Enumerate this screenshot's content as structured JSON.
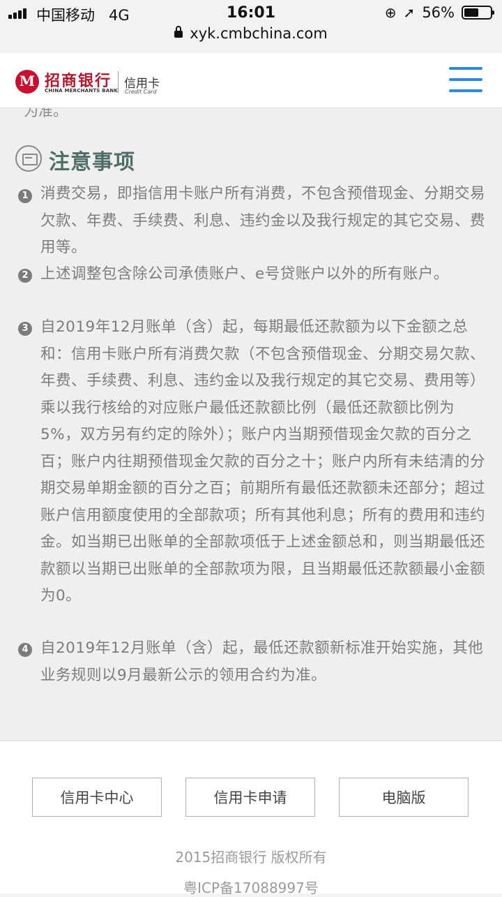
{
  "status_bar": {
    "carrier": "中国移动",
    "network": "4G",
    "time": "16:01",
    "battery": "56%",
    "battery_level": 0.56
  },
  "url_bar": {
    "url": "xyk.cmbchina.com"
  },
  "header": {
    "logo_cn": "招商银行",
    "logo_en": "CHINA MERCHANTS BANK",
    "logo_card": "信用卡",
    "logo_card_en": "Credit Card"
  },
  "content": {
    "cut_off_text": "为准。",
    "section_title": "注意事项",
    "items": [
      {
        "num": "1",
        "text": "消费交易，即指信用卡账户所有消费，不包含预借现金、分期交易欠款、年费、手续费、利息、违约金以及我行规定的其它交易、费用等。"
      },
      {
        "num": "2",
        "text": "上述调整包含除公司承债账户、e号贷账户以外的所有账户。"
      },
      {
        "num": "3",
        "text": "自2019年12月账单（含）起，每期最低还款额为以下金额之总和：信用卡账户所有消费欠款（不包含预借现金、分期交易欠款、年费、手续费、利息、违约金以及我行规定的其它交易、费用等）乘以我行核给的对应账户最低还款额比例（最低还款额比例为5%，双方另有约定的除外）；账户内当期预借现金欠款的百分之百；账户内往期预借现金欠款的百分之十；账户内所有未结清的分期交易单期金额的百分之百；前期所有最低还款额未还部分；超过账户信用额度使用的全部款项；所有其他利息；所有的费用和违约金。如当期已出账单的全部款项低于上述金额总和，则当期最低还款额以当期已出账单的全部款项为限，且当期最低还款额最小金额为0。"
      },
      {
        "num": "4",
        "text": "自2019年12月账单（含）起，最低还款额新标准开始实施，其他业务规则以9月最新公示的领用合约为准。"
      }
    ]
  },
  "footer": {
    "buttons": [
      "信用卡中心",
      "信用卡申请",
      "电脑版"
    ],
    "copyright": "2015招商银行 版权所有",
    "icp": "粤ICP备17088997号"
  }
}
